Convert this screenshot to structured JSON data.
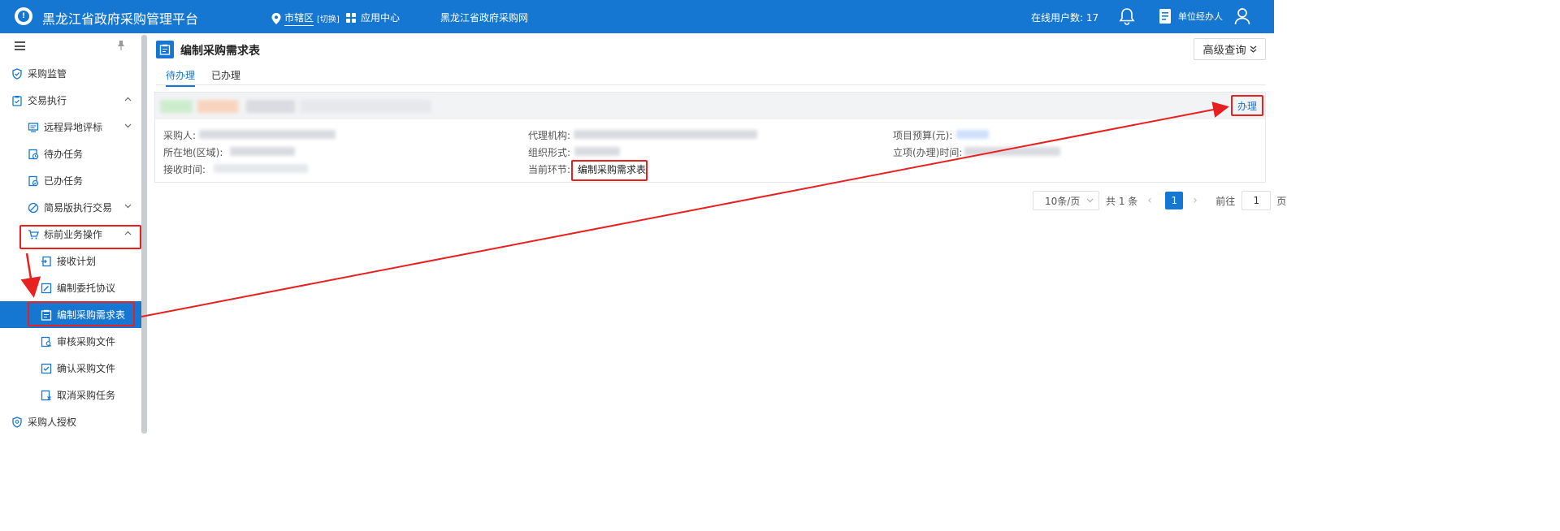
{
  "header": {
    "title": "黑龙江省政府采购管理平台",
    "region": "市辖区",
    "region_switch": "[切换]",
    "app_center": "应用中心",
    "portal_link": "黑龙江省政府采购网",
    "online_label": "在线用户数: 17",
    "unit_manager": "单位经办人"
  },
  "sidebar": {
    "items": [
      {
        "label": "采购监管"
      },
      {
        "label": "交易执行"
      },
      {
        "label": "远程异地评标"
      },
      {
        "label": "待办任务"
      },
      {
        "label": "已办任务"
      },
      {
        "label": "简易版执行交易"
      },
      {
        "label": "标前业务操作"
      },
      {
        "label": "接收计划"
      },
      {
        "label": "编制委托协议"
      },
      {
        "label": "编制采购需求表"
      },
      {
        "label": "审核采购文件"
      },
      {
        "label": "确认采购文件"
      },
      {
        "label": "取消采购任务"
      },
      {
        "label": "采购人授权"
      }
    ]
  },
  "main": {
    "page_title": "编制采购需求表",
    "advanced_search": "高级查询",
    "tabs": [
      {
        "label": "待办理",
        "active": true
      },
      {
        "label": "已办理",
        "active": false
      }
    ],
    "card": {
      "action_label": "办理",
      "fields": {
        "purchaser": "采购人:",
        "agency": "代理机构:",
        "budget": "项目预算(元):",
        "location": "所在地(区域):",
        "org_form": "组织形式:",
        "project_time": "立项(办理)时间:",
        "receive_time": "接收时间:",
        "current_stage": "当前环节:",
        "current_stage_value": "编制采购需求表"
      }
    },
    "pagination": {
      "page_size": "10条/页",
      "total": "共 1 条",
      "current_page": "1",
      "goto_label": "前往",
      "goto_value": "1",
      "page_unit": "页"
    }
  },
  "colors": {
    "primary": "#1677d2",
    "highlight": "#e82020"
  }
}
